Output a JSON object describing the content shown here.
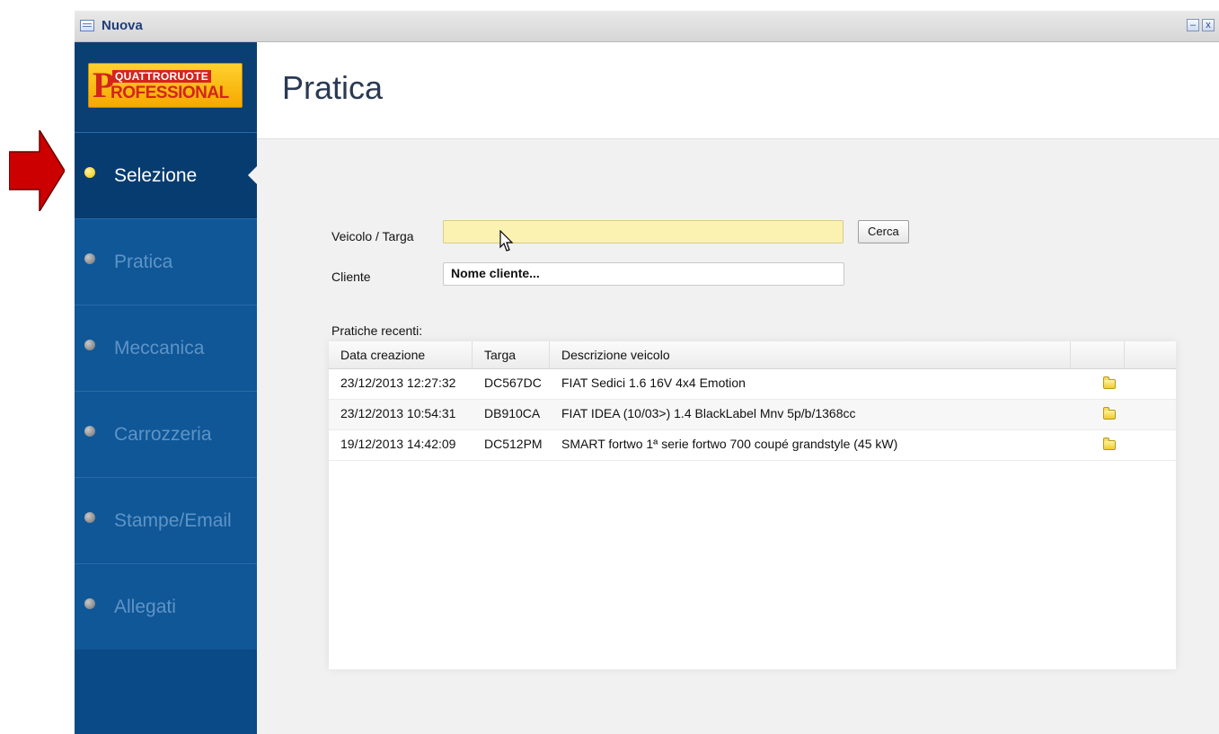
{
  "window": {
    "title": "Nuova",
    "minimize_glyph": "–",
    "close_glyph": "x"
  },
  "logo": {
    "letter": "P",
    "line1": "QUATTRORUOTE",
    "line2": "ROFESSIONAL"
  },
  "sidebar": {
    "items": [
      {
        "label": "Selezione",
        "active": true
      },
      {
        "label": "Pratica",
        "active": false
      },
      {
        "label": "Meccanica",
        "active": false
      },
      {
        "label": "Carrozzeria",
        "active": false
      },
      {
        "label": "Stampe/Email",
        "active": false
      },
      {
        "label": "Allegati",
        "active": false
      }
    ]
  },
  "main": {
    "title": "Pratica",
    "form": {
      "vehicle_label": "Veicolo / Targa",
      "vehicle_value": "",
      "search_button": "Cerca",
      "client_label": "Cliente",
      "client_value": "Nome cliente..."
    },
    "recent": {
      "label": "Pratiche recenti:",
      "columns": [
        "Data creazione",
        "Targa",
        "Descrizione veicolo",
        "",
        ""
      ],
      "rows": [
        {
          "date": "23/12/2013 12:27:32",
          "plate": "DC567DC",
          "description": "FIAT Sedici 1.6 16V 4x4 Emotion",
          "icon": "folder-icon"
        },
        {
          "date": "23/12/2013 10:54:31",
          "plate": "DB910CA",
          "description": "FIAT IDEA (10/03>) 1.4 BlackLabel Mnv 5p/b/1368cc",
          "icon": "folder-icon"
        },
        {
          "date": "19/12/2013 14:42:09",
          "plate": "DC512PM",
          "description": "SMART fortwo 1ª serie fortwo 700 coupé grandstyle (45 kW)",
          "icon": "folder-icon"
        }
      ]
    }
  },
  "colors": {
    "sidebar": "#0f5797",
    "sidebar_active": "#073c70",
    "annotation_arrow": "#cc0000",
    "vehicle_input": "#fbf2b2"
  }
}
